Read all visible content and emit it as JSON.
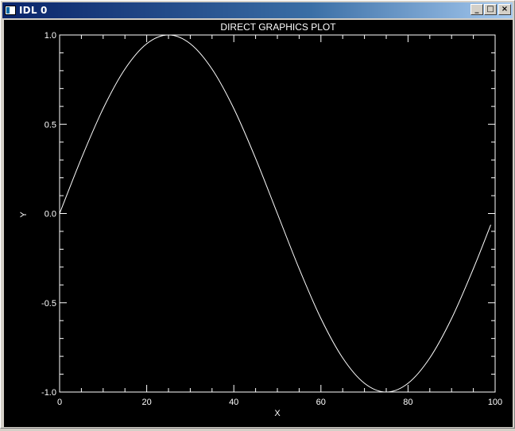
{
  "window": {
    "title": "IDL 0",
    "minimize_icon": "minimize-icon",
    "maximize_icon": "maximize-icon",
    "close_icon": "close-icon",
    "minimize_label": "_",
    "maximize_label": "□",
    "close_label": "×"
  },
  "colors": {
    "background": "#000000",
    "foreground": "#ffffff"
  },
  "chart_data": {
    "type": "line",
    "title": "DIRECT GRAPHICS PLOT",
    "xlabel": "X",
    "ylabel": "Y",
    "xlim": [
      0,
      100
    ],
    "ylim": [
      -1.0,
      1.0
    ],
    "xticks": [
      "0",
      "20",
      "40",
      "60",
      "80",
      "100"
    ],
    "yticks": [
      "-1.0",
      "-0.5",
      "0.0",
      "0.5",
      "1.0"
    ],
    "grid": false,
    "series": [
      {
        "x": [
          0,
          5,
          10,
          15,
          20,
          25,
          30,
          35,
          40,
          45,
          50,
          55,
          60,
          65,
          70,
          75,
          80,
          85,
          90,
          95,
          99
        ],
        "values": [
          0.0,
          0.309,
          0.588,
          0.809,
          0.951,
          1.0,
          0.951,
          0.809,
          0.588,
          0.309,
          0.0,
          -0.309,
          -0.588,
          -0.809,
          -0.951,
          -1.0,
          -0.951,
          -0.809,
          -0.588,
          -0.309,
          -0.063
        ]
      }
    ]
  }
}
